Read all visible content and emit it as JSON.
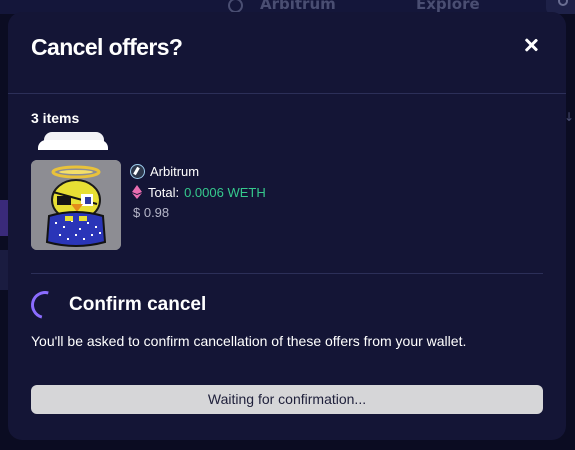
{
  "background": {
    "nav_items": [
      "Arbitrum",
      "Explore"
    ]
  },
  "modal": {
    "title": "Cancel offers?",
    "close_icon": "close-icon",
    "items_count": "3 items",
    "item": {
      "chain_icon": "arbitrum-logo-icon",
      "chain_name": "Arbitrum",
      "total_label": "Total:",
      "total_value": "0.0006 WETH",
      "usd_value": "$ 0.98"
    },
    "confirm": {
      "spinner_icon": "loading-spinner-icon",
      "title": "Confirm cancel",
      "description": "You'll be asked to confirm cancellation of these offers from your wallet.",
      "button_label": "Waiting for confirmation..."
    }
  },
  "colors": {
    "modal_bg": "#141536",
    "accent_green": "#35c98d",
    "spinner_purple": "#8b6cff",
    "button_bg": "#d6d6d8"
  }
}
